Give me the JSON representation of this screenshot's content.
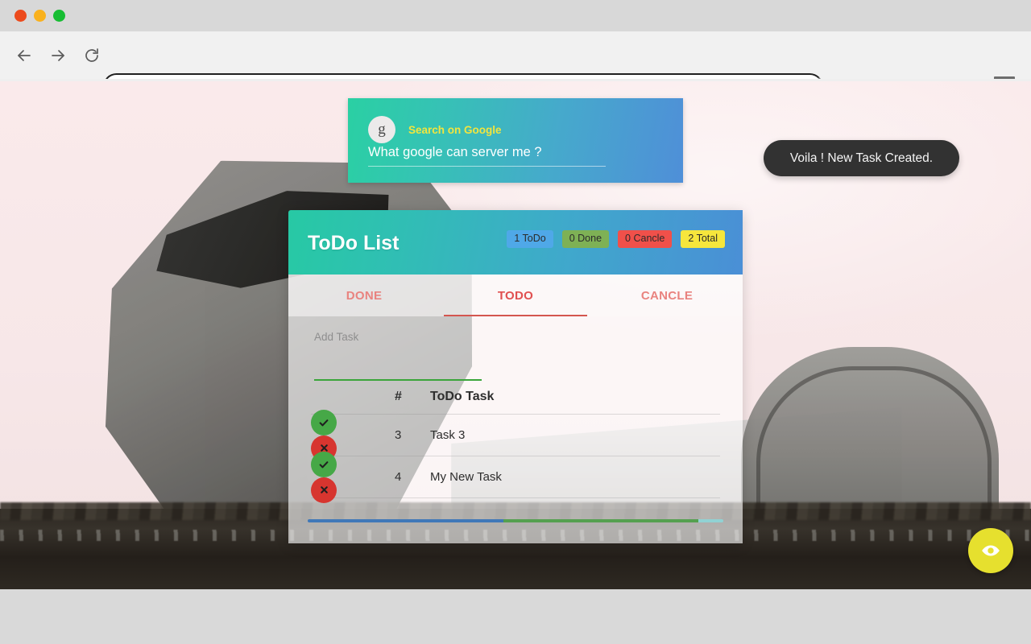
{
  "browser": {
    "traffic_lights": [
      "close",
      "minimize",
      "maximize"
    ],
    "back_icon": "back-arrow-icon",
    "forward_icon": "forward-arrow-icon",
    "reload_icon": "reload-icon",
    "menu_icon": "hamburger-menu-icon",
    "url_value": "",
    "url_placeholder": ""
  },
  "google_card": {
    "avatar_letter": "g",
    "label": "Search on Google",
    "query_value": "What google can server me ?",
    "query_placeholder": "What google can server me ?"
  },
  "toast": {
    "message": "Voila ! New Task Created."
  },
  "todo": {
    "title": "ToDo List",
    "badges": [
      {
        "label": "1 ToDo",
        "color": "#4fa8e8"
      },
      {
        "label": "0 Done",
        "color": "#7eb155"
      },
      {
        "label": "0 Cancle",
        "color": "#f0504a"
      },
      {
        "label": "2 Total",
        "color": "#f6e63c"
      }
    ],
    "tabs": [
      {
        "label": "DONE",
        "active": false
      },
      {
        "label": "TODO",
        "active": true
      },
      {
        "label": "CANCLE",
        "active": false
      }
    ],
    "add_task_placeholder": "Add Task",
    "add_task_value": "",
    "columns": {
      "num": "#",
      "task": "ToDo Task"
    },
    "rows": [
      {
        "num": "3",
        "task": "Task 3",
        "done_icon": "check-icon",
        "cancel_icon": "cross-icon"
      },
      {
        "num": "4",
        "task": "My New Task",
        "done_icon": "check-icon",
        "cancel_icon": "cross-icon"
      }
    ],
    "progress": {
      "blue_pct": 47,
      "green_pct": 47,
      "teal_pct": 6
    }
  },
  "fab": {
    "icon": "eye-icon",
    "color": "#e6e02e"
  }
}
